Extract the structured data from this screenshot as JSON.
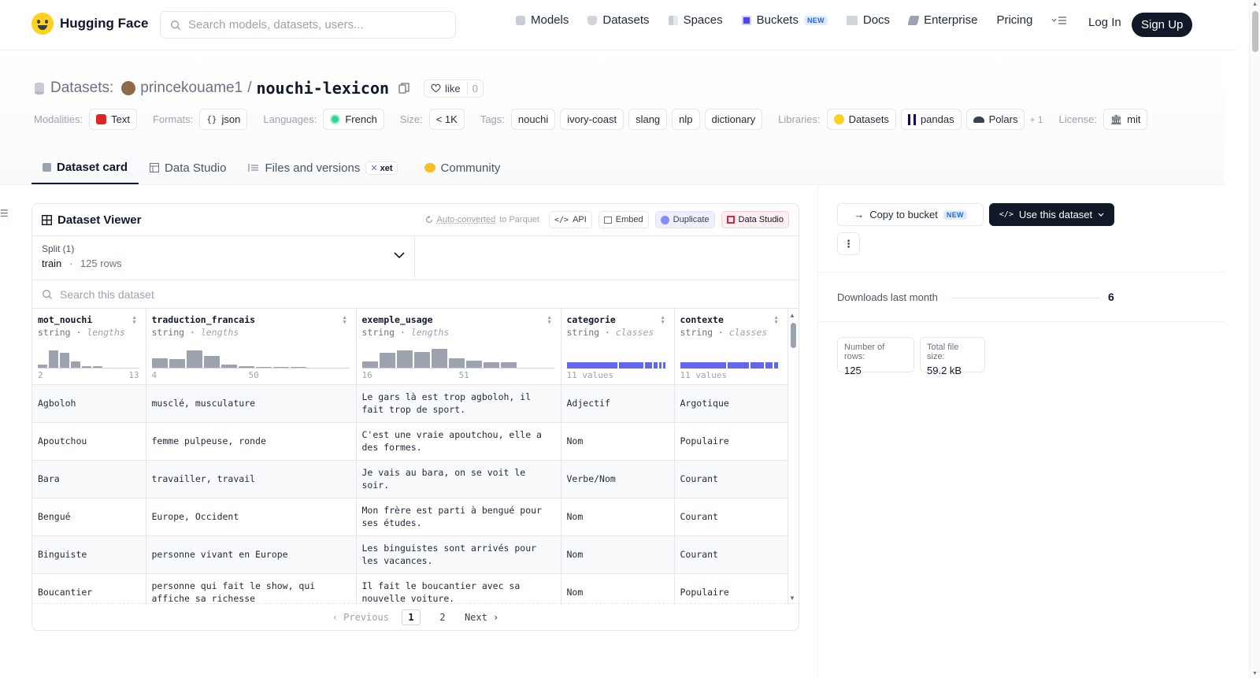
{
  "nav": {
    "brand": "Hugging Face",
    "search_placeholder": "Search models, datasets, users...",
    "links": [
      "Models",
      "Datasets",
      "Spaces",
      "Buckets",
      "Docs",
      "Enterprise",
      "Pricing"
    ],
    "buckets_badge": "NEW",
    "login": "Log In",
    "signup": "Sign Up"
  },
  "header": {
    "datasets_label": "Datasets:",
    "user": "princekouame1",
    "separator": "/",
    "name": "nouchi-lexicon",
    "like_label": "like",
    "like_count": "0"
  },
  "meta": {
    "modalities_label": "Modalities:",
    "modality": "Text",
    "formats_label": "Formats:",
    "format": "json",
    "languages_label": "Languages:",
    "language": "French",
    "size_label": "Size:",
    "size": "< 1K",
    "tags_label": "Tags:",
    "tags": [
      "nouchi",
      "ivory-coast",
      "slang",
      "nlp",
      "dictionary"
    ],
    "libraries_label": "Libraries:",
    "libraries": [
      "Datasets",
      "pandas",
      "Polars"
    ],
    "libraries_more": "+ 1",
    "license_label": "License:",
    "license": "mit"
  },
  "tabs": {
    "card": "Dataset card",
    "studio": "Data Studio",
    "files": "Files and versions",
    "xet": "xet",
    "community": "Community"
  },
  "viewer": {
    "title": "Dataset Viewer",
    "auto_converted": "Auto-converted",
    "to_parquet": "to Parquet",
    "api": "API",
    "embed": "Embed",
    "duplicate": "Duplicate",
    "data_studio": "Data Studio",
    "split_label": "Split (1)",
    "split_value": "train",
    "split_dot": "·",
    "split_rows": "125 rows",
    "search_placeholder": "Search this dataset",
    "columns": [
      {
        "name": "mot_nouchi",
        "type": "string",
        "stat": "lengths",
        "min": "2",
        "max": "13",
        "hist": [
          0.2,
          0.9,
          0.75,
          0.35,
          0.1,
          0.1
        ]
      },
      {
        "name": "traduction_francais",
        "type": "string",
        "stat": "lengths",
        "min": "4",
        "max": "50",
        "hist": [
          0.5,
          0.45,
          0.9,
          0.6,
          0.2,
          0.1,
          0.03,
          0.05,
          0.03
        ]
      },
      {
        "name": "exemple_usage",
        "type": "string",
        "stat": "lengths",
        "min": "16",
        "max": "51",
        "hist": [
          0.35,
          0.75,
          0.9,
          0.8,
          0.95,
          0.5,
          0.4,
          0.3,
          0.3
        ]
      },
      {
        "name": "categorie",
        "type": "string",
        "stat": "classes",
        "summary": "11 values",
        "classes": [
          0.55,
          0.27,
          0.08,
          0.04,
          0.03,
          0.03
        ]
      },
      {
        "name": "contexte",
        "type": "string",
        "stat": "classes",
        "summary": "11 values",
        "classes": [
          0.5,
          0.23,
          0.15,
          0.08,
          0.04
        ]
      }
    ],
    "rows": [
      [
        "Agboloh",
        "musclé, musculature",
        "Le gars là est trop agboloh, il fait trop de sport.",
        "Adjectif",
        "Argotique"
      ],
      [
        "Apoutchou",
        "femme pulpeuse, ronde",
        "C'est une vraie apoutchou, elle a des formes.",
        "Nom",
        "Populaire"
      ],
      [
        "Bara",
        "travailler, travail",
        "Je vais au bara, on se voit le soir.",
        "Verbe/Nom",
        "Courant"
      ],
      [
        "Bengué",
        "Europe, Occident",
        "Mon frère est parti à bengué pour ses études.",
        "Nom",
        "Courant"
      ],
      [
        "Binguiste",
        "personne vivant en Europe",
        "Les binguistes sont arrivés pour les vacances.",
        "Nom",
        "Courant"
      ],
      [
        "Boucantier",
        "personne qui fait le show, qui affiche sa richesse",
        "Il fait le boucantier avec sa nouvelle voiture.",
        "Nom",
        "Populaire"
      ]
    ],
    "pager": {
      "prev": "Previous",
      "pages": [
        "1",
        "2"
      ],
      "current": "1",
      "next": "Next"
    }
  },
  "sidebar": {
    "copy_bucket": "Copy to bucket",
    "copy_badge": "NEW",
    "use_dataset": "Use this dataset",
    "more": "⋮",
    "downloads_label": "Downloads last month",
    "downloads_value": "6",
    "rows_label": "Number of rows:",
    "rows_value": "125",
    "size_label": "Total file size:",
    "size_value": "59.2 kB"
  },
  "colors": {
    "accent": "#6366f1",
    "dark": "#111827",
    "logo": "#ffd21e"
  }
}
